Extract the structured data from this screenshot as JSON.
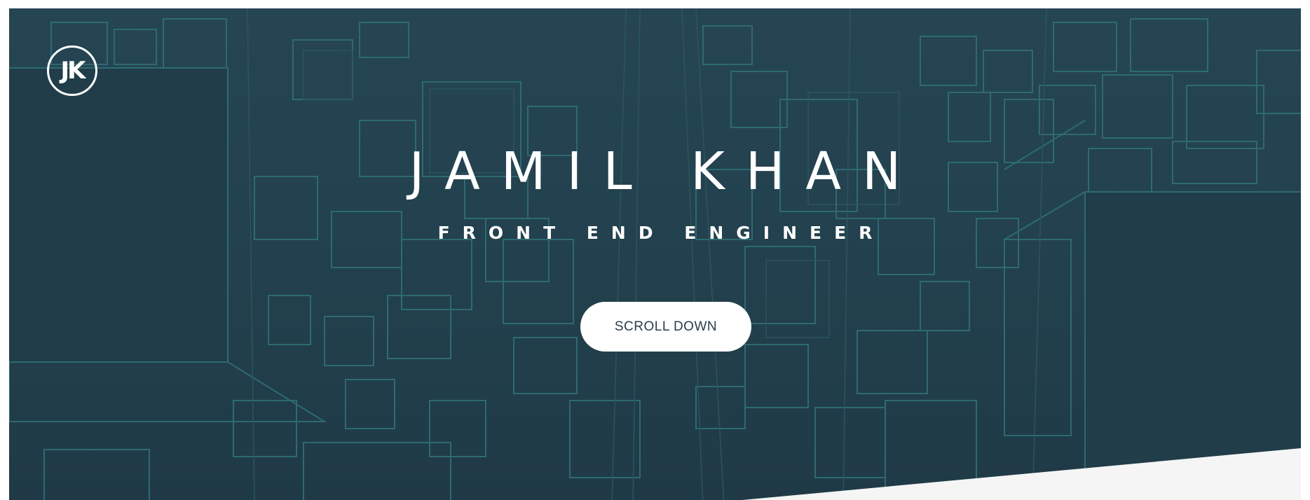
{
  "logo": {
    "initials": "JK"
  },
  "hero": {
    "name": "JAMIL KHAN",
    "subtitle": "FRONT END ENGINEER",
    "scroll_label": "SCROLL DOWN"
  },
  "colors": {
    "hero_background": "#22404d",
    "pattern_lines": "#2e6a72",
    "text": "#ffffff",
    "button_background": "#ffffff",
    "button_text": "#2b3d4c",
    "below_fold": "#f5f5f5"
  }
}
